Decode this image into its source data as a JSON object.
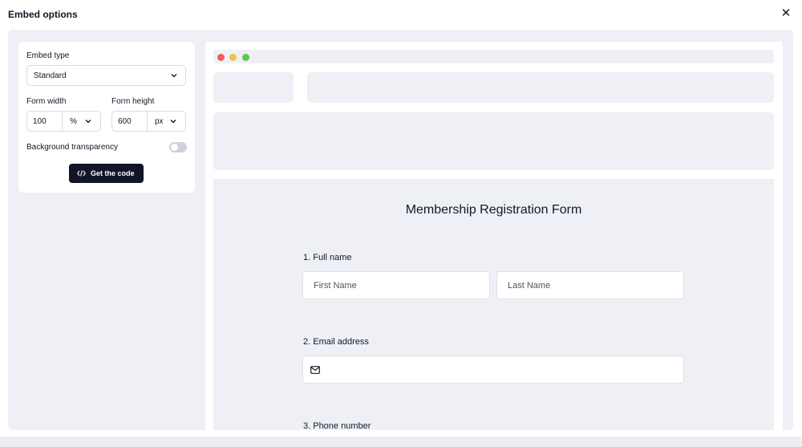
{
  "dialog": {
    "title": "Embed options",
    "close_icon": "close-icon"
  },
  "settings": {
    "embed_type_label": "Embed type",
    "embed_type_value": "Standard",
    "form_width_label": "Form width",
    "form_width_value": "100",
    "form_width_unit": "%",
    "form_height_label": "Form height",
    "form_height_value": "600",
    "form_height_unit": "px",
    "transparency_label": "Background transparency",
    "transparency_on": false,
    "get_code_label": "Get the code",
    "get_code_icon": "code-icon"
  },
  "preview": {
    "window_dot_colors": [
      "#ed5f57",
      "#f4bf4f",
      "#61c554"
    ],
    "form_title": "Membership Registration Form",
    "questions": [
      {
        "label": "1.  Full name",
        "fields": [
          "First Name",
          "Last Name"
        ]
      },
      {
        "label": "2. Email address",
        "icon": "mail-icon"
      },
      {
        "label": "3. Phone number"
      }
    ]
  }
}
